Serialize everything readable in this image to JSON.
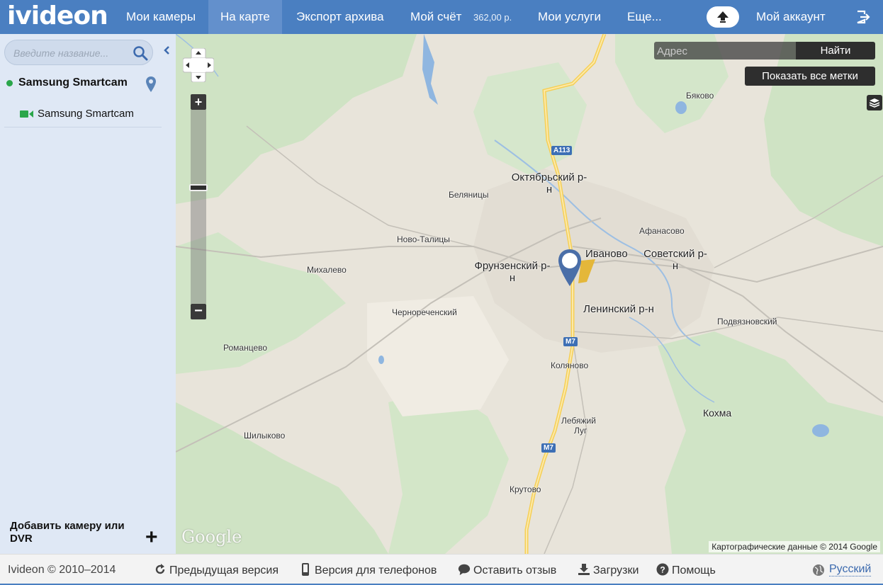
{
  "header": {
    "logo": "ivideon",
    "nav": {
      "cameras": "Мои камеры",
      "map": "На карте",
      "export": "Экспорт архива",
      "account_balance": "Мой счёт",
      "balance_value": "362,00 р.",
      "services": "Мои услуги",
      "more": "Еще...",
      "my_account": "Мой аккаунт"
    },
    "active_tab": "На карте",
    "accent_color": "#4a7fc1",
    "icons": {
      "upload": "upload-icon",
      "logout": "logout-icon"
    }
  },
  "sidebar": {
    "search_placeholder": "Введите название...",
    "group": {
      "name": "Samsung Smartcam",
      "status_color": "#2aa64a"
    },
    "cameras": [
      {
        "name": "Samsung Smartcam"
      }
    ],
    "add_camera": "Добавить камеру или DVR"
  },
  "map": {
    "address_placeholder": "Адрес",
    "find_button": "Найти",
    "show_all_button": "Показать все метки",
    "zoom_level": 0.6,
    "places": {
      "byakovo": "Бяково",
      "belyanitsy": "Беляницы",
      "novo_talitsy": "Ново-Талицы",
      "mikhalevo": "Михалево",
      "chernorechensky": "Чернореченский",
      "romantsevo": "Романцево",
      "shilykovo": "Шилыково",
      "afanasovo": "Афанасово",
      "ivanovo": "Иваново",
      "podvyaznovsky": "Подвязновский",
      "kolyanovo": "Коляново",
      "kokhma": "Кохма",
      "lebyazhiy_lug_1": "Лебяжий",
      "lebyazhiy_lug_2": "Луг",
      "krutovo": "Крутово"
    },
    "districts": {
      "oktyabrsky": "Октябрьский р-н",
      "frunzensky": "Фрунзенский р-н",
      "sovetsky": "Советский р-н",
      "leninsky": "Ленинский р-н"
    },
    "roads": {
      "a113": "A113",
      "m7_north": "M7",
      "m7_south": "M7"
    },
    "google_logo": "Google",
    "attribution": "Картографические данные © 2014 Google"
  },
  "footer": {
    "copyright": "Ivideon © 2010–2014",
    "prev_version": "Предыдущая версия",
    "mobile_version": "Версия для телефонов",
    "feedback": "Оставить отзыв",
    "downloads": "Загрузки",
    "help": "Помощь",
    "language": "Русский"
  }
}
